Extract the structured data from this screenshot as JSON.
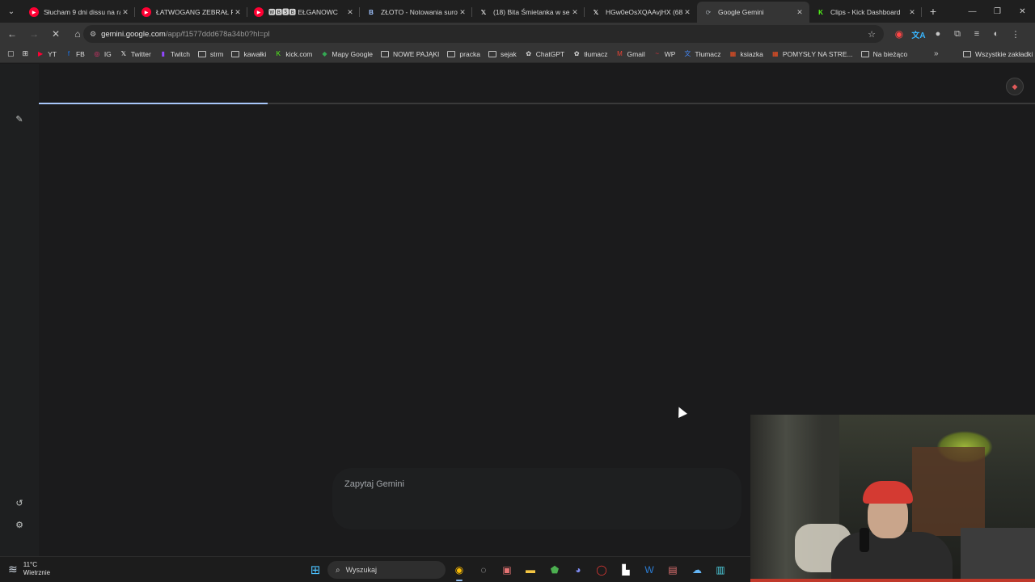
{
  "browser": {
    "tabs": [
      {
        "title": "Słucham 9 dni dissu na ra",
        "icon": "youtube-icon"
      },
      {
        "title": "ŁATWOGANG ZEBRAŁ PO",
        "icon": "youtube-icon"
      },
      {
        "title": "🆆🅱🆂🅱 EŁGANOWC",
        "icon": "youtube-icon"
      },
      {
        "title": "ZŁOTO - Notowania surow",
        "icon": "bankier-icon"
      },
      {
        "title": "(18) Bita Śmietanka w sen",
        "icon": "x-icon"
      },
      {
        "title": "HGw0eOsXQAAvjHX (680",
        "icon": "x-icon"
      },
      {
        "title": "Google Gemini",
        "icon": "loading-icon",
        "active": true
      },
      {
        "title": "Clips - Kick Dashboard",
        "icon": "kick-icon"
      }
    ],
    "url_host": "gemini.google.com",
    "url_path": "/app/f1577ddd678a34b0?hl=pl",
    "bookmarks": [
      {
        "label": "YT",
        "icon": "youtube-icon",
        "color": "#ff0033"
      },
      {
        "label": "FB",
        "icon": "facebook-icon",
        "color": "#1877f2"
      },
      {
        "label": "IG",
        "icon": "instagram-icon",
        "color": "#e1306c"
      },
      {
        "label": "Twitter",
        "icon": "x-icon",
        "color": "#ffffff"
      },
      {
        "label": "Twitch",
        "icon": "twitch-icon",
        "color": "#9146ff"
      },
      {
        "label": "strm",
        "icon": "folder-icon"
      },
      {
        "label": "kawałki",
        "icon": "folder-icon"
      },
      {
        "label": "kick.com",
        "icon": "kick-icon",
        "color": "#53fc18"
      },
      {
        "label": "Mapy Google",
        "icon": "maps-icon",
        "color": "#34a853"
      },
      {
        "label": "NOWE PAJĄKI",
        "icon": "folder-icon"
      },
      {
        "label": "pracka",
        "icon": "folder-icon"
      },
      {
        "label": "sejak",
        "icon": "folder-icon"
      },
      {
        "label": "ChatGPT",
        "icon": "chatgpt-icon",
        "color": "#dddddd"
      },
      {
        "label": "tłumacz",
        "icon": "chatgpt-icon",
        "color": "#dddddd"
      },
      {
        "label": "Gmail",
        "icon": "gmail-icon",
        "color": "#ea4335"
      },
      {
        "label": "WP",
        "icon": "wp-icon",
        "color": "#e4303c"
      },
      {
        "label": "Tłumacz",
        "icon": "translate-icon",
        "color": "#4285f4"
      },
      {
        "label": "ksiazka",
        "icon": "windows-icon",
        "color": "#f25022"
      },
      {
        "label": "POMYSŁY NA STRE...",
        "icon": "windows-icon",
        "color": "#f25022"
      },
      {
        "label": "Na bieżąco",
        "icon": "folder-icon"
      }
    ],
    "all_bookmarks": "Wszystkie zakładki"
  },
  "gemini": {
    "prompt_placeholder": "Zapytaj Gemini",
    "load_progress": 0.23
  },
  "taskbar": {
    "temperature": "11°C",
    "condition": "Wietrznie",
    "search_placeholder": "Wyszukaj"
  }
}
